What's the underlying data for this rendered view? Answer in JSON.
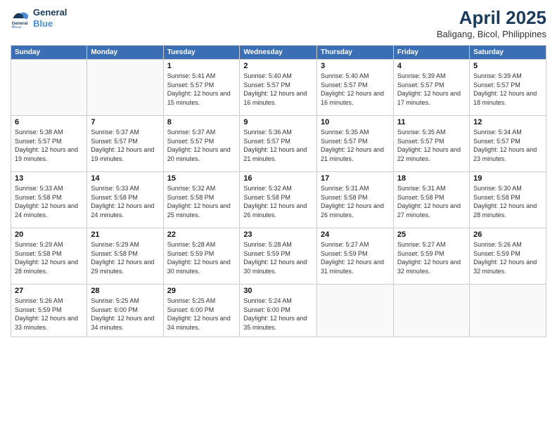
{
  "logo": {
    "line1": "General",
    "line2": "Blue"
  },
  "title": "April 2025",
  "subtitle": "Baligang, Bicol, Philippines",
  "days_of_week": [
    "Sunday",
    "Monday",
    "Tuesday",
    "Wednesday",
    "Thursday",
    "Friday",
    "Saturday"
  ],
  "weeks": [
    [
      {
        "day": "",
        "info": ""
      },
      {
        "day": "",
        "info": ""
      },
      {
        "day": "1",
        "info": "Sunrise: 5:41 AM\nSunset: 5:57 PM\nDaylight: 12 hours and 15 minutes."
      },
      {
        "day": "2",
        "info": "Sunrise: 5:40 AM\nSunset: 5:57 PM\nDaylight: 12 hours and 16 minutes."
      },
      {
        "day": "3",
        "info": "Sunrise: 5:40 AM\nSunset: 5:57 PM\nDaylight: 12 hours and 16 minutes."
      },
      {
        "day": "4",
        "info": "Sunrise: 5:39 AM\nSunset: 5:57 PM\nDaylight: 12 hours and 17 minutes."
      },
      {
        "day": "5",
        "info": "Sunrise: 5:39 AM\nSunset: 5:57 PM\nDaylight: 12 hours and 18 minutes."
      }
    ],
    [
      {
        "day": "6",
        "info": "Sunrise: 5:38 AM\nSunset: 5:57 PM\nDaylight: 12 hours and 19 minutes."
      },
      {
        "day": "7",
        "info": "Sunrise: 5:37 AM\nSunset: 5:57 PM\nDaylight: 12 hours and 19 minutes."
      },
      {
        "day": "8",
        "info": "Sunrise: 5:37 AM\nSunset: 5:57 PM\nDaylight: 12 hours and 20 minutes."
      },
      {
        "day": "9",
        "info": "Sunrise: 5:36 AM\nSunset: 5:57 PM\nDaylight: 12 hours and 21 minutes."
      },
      {
        "day": "10",
        "info": "Sunrise: 5:35 AM\nSunset: 5:57 PM\nDaylight: 12 hours and 21 minutes."
      },
      {
        "day": "11",
        "info": "Sunrise: 5:35 AM\nSunset: 5:57 PM\nDaylight: 12 hours and 22 minutes."
      },
      {
        "day": "12",
        "info": "Sunrise: 5:34 AM\nSunset: 5:57 PM\nDaylight: 12 hours and 23 minutes."
      }
    ],
    [
      {
        "day": "13",
        "info": "Sunrise: 5:33 AM\nSunset: 5:58 PM\nDaylight: 12 hours and 24 minutes."
      },
      {
        "day": "14",
        "info": "Sunrise: 5:33 AM\nSunset: 5:58 PM\nDaylight: 12 hours and 24 minutes."
      },
      {
        "day": "15",
        "info": "Sunrise: 5:32 AM\nSunset: 5:58 PM\nDaylight: 12 hours and 25 minutes."
      },
      {
        "day": "16",
        "info": "Sunrise: 5:32 AM\nSunset: 5:58 PM\nDaylight: 12 hours and 26 minutes."
      },
      {
        "day": "17",
        "info": "Sunrise: 5:31 AM\nSunset: 5:58 PM\nDaylight: 12 hours and 26 minutes."
      },
      {
        "day": "18",
        "info": "Sunrise: 5:31 AM\nSunset: 5:58 PM\nDaylight: 12 hours and 27 minutes."
      },
      {
        "day": "19",
        "info": "Sunrise: 5:30 AM\nSunset: 5:58 PM\nDaylight: 12 hours and 28 minutes."
      }
    ],
    [
      {
        "day": "20",
        "info": "Sunrise: 5:29 AM\nSunset: 5:58 PM\nDaylight: 12 hours and 28 minutes."
      },
      {
        "day": "21",
        "info": "Sunrise: 5:29 AM\nSunset: 5:58 PM\nDaylight: 12 hours and 29 minutes."
      },
      {
        "day": "22",
        "info": "Sunrise: 5:28 AM\nSunset: 5:59 PM\nDaylight: 12 hours and 30 minutes."
      },
      {
        "day": "23",
        "info": "Sunrise: 5:28 AM\nSunset: 5:59 PM\nDaylight: 12 hours and 30 minutes."
      },
      {
        "day": "24",
        "info": "Sunrise: 5:27 AM\nSunset: 5:59 PM\nDaylight: 12 hours and 31 minutes."
      },
      {
        "day": "25",
        "info": "Sunrise: 5:27 AM\nSunset: 5:59 PM\nDaylight: 12 hours and 32 minutes."
      },
      {
        "day": "26",
        "info": "Sunrise: 5:26 AM\nSunset: 5:59 PM\nDaylight: 12 hours and 32 minutes."
      }
    ],
    [
      {
        "day": "27",
        "info": "Sunrise: 5:26 AM\nSunset: 5:59 PM\nDaylight: 12 hours and 33 minutes."
      },
      {
        "day": "28",
        "info": "Sunrise: 5:25 AM\nSunset: 6:00 PM\nDaylight: 12 hours and 34 minutes."
      },
      {
        "day": "29",
        "info": "Sunrise: 5:25 AM\nSunset: 6:00 PM\nDaylight: 12 hours and 34 minutes."
      },
      {
        "day": "30",
        "info": "Sunrise: 5:24 AM\nSunset: 6:00 PM\nDaylight: 12 hours and 35 minutes."
      },
      {
        "day": "",
        "info": ""
      },
      {
        "day": "",
        "info": ""
      },
      {
        "day": "",
        "info": ""
      }
    ]
  ]
}
